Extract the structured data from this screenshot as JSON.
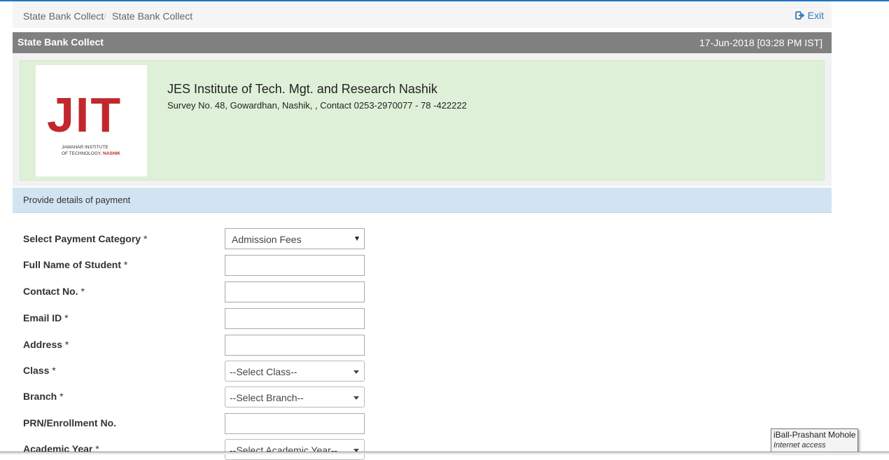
{
  "breadcrumb": {
    "items": [
      "State Bank Collect",
      "State Bank Collect"
    ],
    "separator": "/"
  },
  "exit_label": "Exit",
  "header": {
    "title": "State Bank Collect",
    "datetime": "17-Jun-2018 [03:28 PM IST]"
  },
  "institute": {
    "logo_text": "JIT",
    "logo_sub_line1": "JAWAHAR INSTITUTE",
    "logo_sub_line2": "OF TECHNOLOGY,",
    "logo_sub_city": "NASHIK",
    "name": "JES Institute of Tech. Mgt. and Research Nashik",
    "address": "Survey No. 48, Gowardhan, Nashik, , Contact 0253-2970077 - 78 -422222"
  },
  "info_bar": "Provide details of payment",
  "form": {
    "required_mark": "*",
    "payment_category": {
      "label": "Select Payment Category",
      "value": "Admission Fees"
    },
    "full_name": {
      "label": "Full Name of Student",
      "value": ""
    },
    "contact": {
      "label": "Contact No.",
      "value": ""
    },
    "email": {
      "label": "Email ID",
      "value": ""
    },
    "address": {
      "label": "Address",
      "value": ""
    },
    "class": {
      "label": "Class",
      "value": "--Select Class--"
    },
    "branch": {
      "label": "Branch",
      "value": "--Select Branch--"
    },
    "prn": {
      "label": "PRN/Enrollment No.",
      "value": ""
    },
    "academic_year": {
      "label": "Academic Year",
      "value": "--Select Academic Year--"
    }
  },
  "tooltip": {
    "line1": "iBall-Prashant Mohole",
    "line2": "Internet access"
  },
  "colors": {
    "accent": "#1f74c5",
    "header_bg": "#808080",
    "institute_bg": "#dff0d8",
    "info_bg": "#d2e4f2",
    "logo_red": "#c1272d"
  }
}
